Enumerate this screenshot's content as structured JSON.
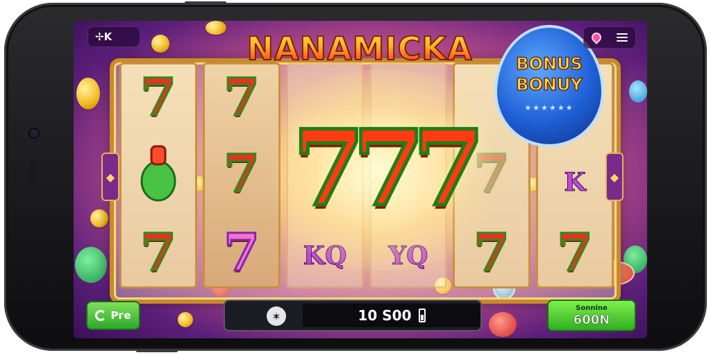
{
  "top_bar": {
    "left_button_label": "✢K",
    "right_icons": [
      "map-pin-icon",
      "menu-icon"
    ]
  },
  "title": "NANAMICKA",
  "bonus_badge": {
    "line1": "BONUS",
    "line2": "BONUY",
    "stars": "★★★★★★"
  },
  "reels": {
    "col1": [
      "7",
      "",
      "7"
    ],
    "col2": [
      "7",
      "7",
      "7"
    ],
    "col3_bottom": "KQ",
    "col4_bottom": "YQ",
    "col5": [
      "7",
      "7"
    ],
    "col6": [
      "K",
      "7"
    ]
  },
  "center_symbol": "777",
  "bottom": {
    "left_button_label": "Pгe",
    "bet_value": "10 S00",
    "spin_top_label": "Sonnine",
    "spin_amount": "600N"
  }
}
